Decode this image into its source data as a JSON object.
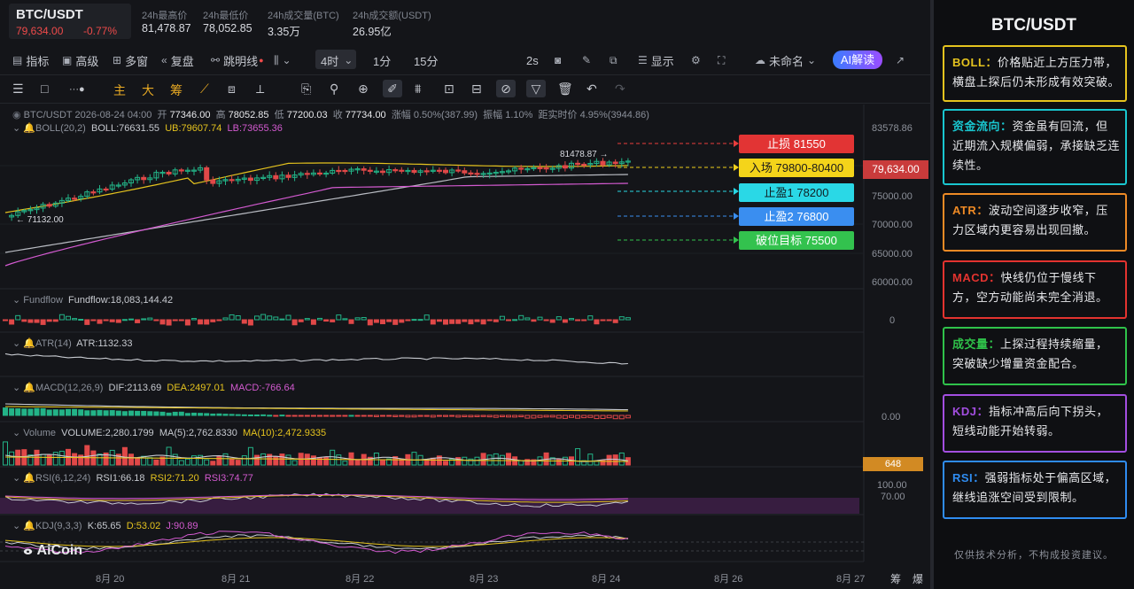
{
  "pair": {
    "name": "BTC/USDT",
    "price": "79,634.00",
    "change": "-0.77%"
  },
  "stats": [
    {
      "label": "24h最高价",
      "value": "81,478.87"
    },
    {
      "label": "24h最低价",
      "value": "78,052.85"
    },
    {
      "label": "24h成交量(BTC)",
      "value": "3.35万"
    },
    {
      "label": "24h成交额(USDT)",
      "value": "26.95亿"
    }
  ],
  "toolbar": {
    "indicator": "指标",
    "advanced": "高级",
    "multi": "多窗",
    "replay": "复盘",
    "jump": "跳明线",
    "interval": "4时",
    "i1": "1分",
    "i2": "15分",
    "refresh": "2s",
    "display": "显示",
    "unnamed": "未命名",
    "ai": "AI解读"
  },
  "tools": {
    "main": "主",
    "big": "大",
    "chip": "筹"
  },
  "info": {
    "line": "BTC/USDT  2026-08-24 04:00",
    "open_l": "开",
    "open": "77346.00",
    "high_l": "高",
    "high": "78052.85",
    "low_l": "低",
    "low": "77200.03",
    "close_l": "收",
    "close": "77734.00",
    "chg": "涨幅 0.50%(387.99)",
    "amp": "振幅 1.10%",
    "dist": "距实时价 4.95%(3944.86)",
    "boll_name": "BOLL(20,2)",
    "boll": "BOLL:76631.55",
    "ub": "UB:79607.74",
    "lb": "LB:73655.36",
    "ff_name": "Fundflow",
    "ff": "Fundflow:18,083,144.42",
    "atr_name": "ATR(14)",
    "atr": "ATR:1132.33",
    "macd_name": "MACD(12,26,9)",
    "dif": "DIF:2113.69",
    "dea": "DEA:2497.01",
    "macd": "MACD:-766.64",
    "vol_name": "Volume",
    "vol": "VOLUME:2,280.1799",
    "ma5": "MA(5):2,762.8330",
    "ma10": "MA(10):2,472.9335",
    "rsi_name": "RSI(6,12,24)",
    "rsi1": "RSI1:66.18",
    "rsi2": "RSI2:71.20",
    "rsi3": "RSI3:74.77",
    "kdj_name": "KDJ(9,3,3)",
    "k": "K:65.65",
    "d": "D:53.02",
    "j": "J:90.89"
  },
  "levels": {
    "stop": "止损  81550",
    "entry": "入场  79800-80400",
    "tp1": "止盈1  78200",
    "tp2": "止盈2  76800",
    "break": "破位目标  75500"
  },
  "chart_labels": {
    "hi": "81478.87 →",
    "lo": "← 71132.00"
  },
  "axis": {
    "p1": "83578.86",
    "p2": "75000.00",
    "p3": "70000.00",
    "p4": "65000.00",
    "p5": "60000.00",
    "price_tag": "79,634.00",
    "ff0": "0",
    "macd0": "0.00",
    "vol_tag": "648",
    "rsi1": "100.00",
    "rsi2": "70.00"
  },
  "dates": [
    "8月 20",
    "8月 21",
    "8月 22",
    "8月 23",
    "8月 24",
    "8月 26",
    "8月 27"
  ],
  "bottom_tools": {
    "a": "筹",
    "b": "爆"
  },
  "logo": "AiCoin",
  "panel": {
    "title": "BTC/USDT",
    "cards": [
      {
        "key": "BOLL：",
        "text": "价格贴近上方压力带，横盘上探后仍未形成有效突破。",
        "color": "#e5c31e"
      },
      {
        "key": "资金流向：",
        "text": "资金虽有回流，但近期流入规模偏弱，承接缺乏连续性。",
        "color": "#19c6cf"
      },
      {
        "key": "ATR：",
        "text": "波动空间逐步收窄，压力区域内更容易出现回撤。",
        "color": "#ee8a25"
      },
      {
        "key": "MACD：",
        "text": "快线仍位于慢线下方，空方动能尚未完全消退。",
        "color": "#e3332f"
      },
      {
        "key": "成交量：",
        "text": "上探过程持续缩量，突破缺少增量资金配合。",
        "color": "#2fc24a"
      },
      {
        "key": "KDJ：",
        "text": "指标冲高后向下拐头，短线动能开始转弱。",
        "color": "#a34ee0"
      },
      {
        "key": "RSI：",
        "text": "强弱指标处于偏高区域，继线追涨空间受到限制。",
        "color": "#2f8cf0"
      }
    ],
    "disclaimer": "仅供技术分析，不构成投资建议。"
  }
}
